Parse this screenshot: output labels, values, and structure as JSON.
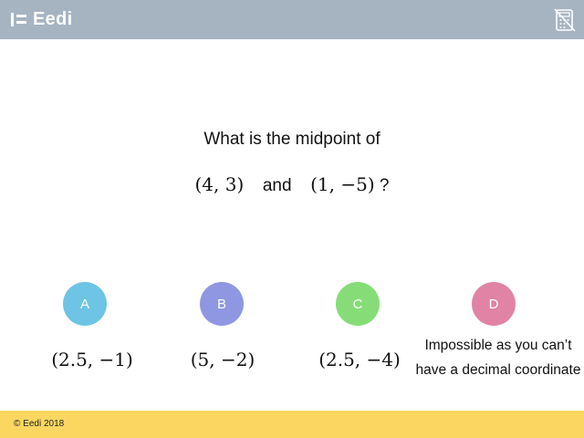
{
  "header": {
    "brand": "Eedi",
    "calculator_icon": "calculator-disabled-icon",
    "colors": {
      "background": "#a6b4c2"
    }
  },
  "question": {
    "line1": "What is the midpoint of",
    "point1": "(4, 3)",
    "connector": "and",
    "point2": "(1, −5)",
    "question_mark": "?"
  },
  "options": [
    {
      "letter": "A",
      "answer": "(2.5, −1)",
      "color": "#6ec4e4"
    },
    {
      "letter": "B",
      "answer": "(5, −2)",
      "color": "#8f97e2"
    },
    {
      "letter": "C",
      "answer": "(2.5, −4)",
      "color": "#86dd78"
    },
    {
      "letter": "D",
      "answer": "Impossible as you can’t have a decimal coordinate",
      "color": "#e183a5"
    }
  ],
  "footer": {
    "copyright": "© Eedi 2018",
    "colors": {
      "background": "#fbd761"
    }
  }
}
